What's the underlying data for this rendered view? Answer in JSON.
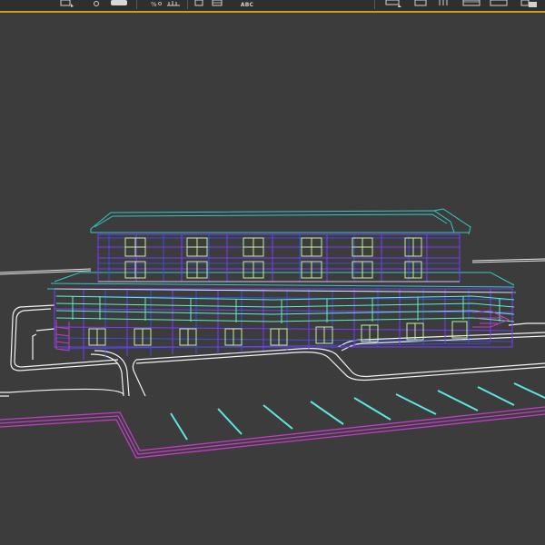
{
  "toolbar": {
    "text_style_label": "ABC",
    "accent_color": "#c8a21a",
    "icons": [
      "select-object-icon",
      "rotate-icon",
      "move-icon",
      "percent-snap-icon",
      "angle-snap-icon",
      "align-icon",
      "edit-named-selection-icon",
      "text-style-icon",
      "render-setup-icon",
      "render-frame-icon",
      "render-icon",
      "material-editor-icon",
      "layer-manager-icon"
    ]
  },
  "viewport": {
    "mode": "wireframe",
    "background_color": "#3c3c3c",
    "colors": {
      "ground": "#ffffff",
      "boundary": "#c43cc8",
      "parking_lines": "#5ee6e0",
      "building_primary": "#7a3cff",
      "building_secondary": "#3c50ff",
      "roof": "#36c8c8",
      "windows": "#c8f0a0",
      "railing": "#5cf0c8"
    }
  }
}
